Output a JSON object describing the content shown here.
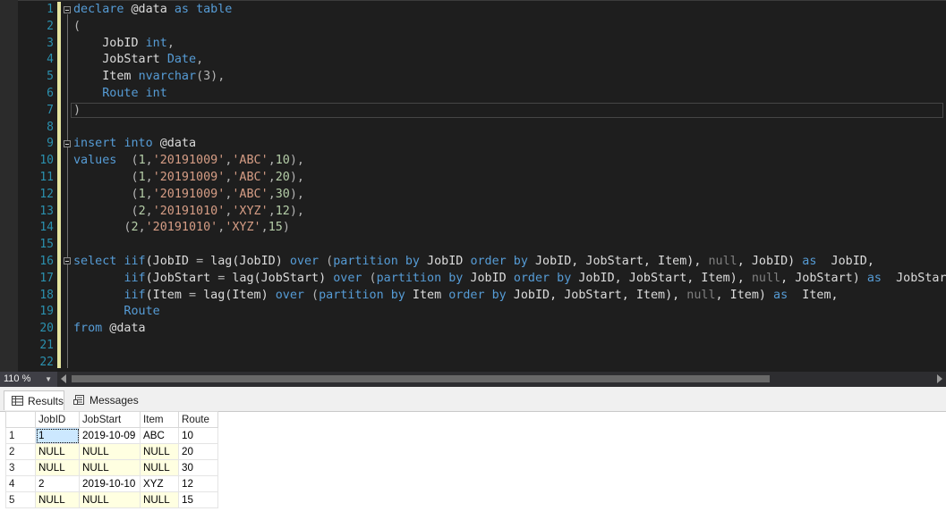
{
  "editor": {
    "line_numbers": [
      "1",
      "2",
      "3",
      "4",
      "5",
      "6",
      "7",
      "8",
      "9",
      "10",
      "11",
      "12",
      "13",
      "14",
      "15",
      "16",
      "17",
      "18",
      "19",
      "20",
      "21",
      "22"
    ],
    "lines": [
      [
        {
          "t": "declare",
          "c": "kw"
        },
        {
          "t": " @data ",
          "c": "fn"
        },
        {
          "t": "as",
          "c": "kw"
        },
        {
          "t": " ",
          "c": "fn"
        },
        {
          "t": "table",
          "c": "kw"
        }
      ],
      [
        {
          "t": "(",
          "c": "pun"
        }
      ],
      [
        {
          "t": "    JobID ",
          "c": "fn"
        },
        {
          "t": "int",
          "c": "kw"
        },
        {
          "t": ",",
          "c": "pun"
        }
      ],
      [
        {
          "t": "    JobStart ",
          "c": "fn"
        },
        {
          "t": "Date",
          "c": "kw"
        },
        {
          "t": ",",
          "c": "pun"
        }
      ],
      [
        {
          "t": "    Item ",
          "c": "fn"
        },
        {
          "t": "nvarchar",
          "c": "kw"
        },
        {
          "t": "(3),",
          "c": "pun"
        }
      ],
      [
        {
          "t": "    Route ",
          "c": "kw"
        },
        {
          "t": "int",
          "c": "kw"
        }
      ],
      [
        {
          "t": ")",
          "c": "pun"
        }
      ],
      [],
      [
        {
          "t": "insert",
          "c": "kw"
        },
        {
          "t": " ",
          "c": "fn"
        },
        {
          "t": "into",
          "c": "kw"
        },
        {
          "t": " @data",
          "c": "fn"
        }
      ],
      [
        {
          "t": "values",
          "c": "kw"
        },
        {
          "t": "  (",
          "c": "pun"
        },
        {
          "t": "1",
          "c": "num"
        },
        {
          "t": ",",
          "c": "pun"
        },
        {
          "t": "'20191009'",
          "c": "str"
        },
        {
          "t": ",",
          "c": "pun"
        },
        {
          "t": "'ABC'",
          "c": "str"
        },
        {
          "t": ",",
          "c": "pun"
        },
        {
          "t": "10",
          "c": "num"
        },
        {
          "t": "),",
          "c": "pun"
        }
      ],
      [
        {
          "t": "        (",
          "c": "pun"
        },
        {
          "t": "1",
          "c": "num"
        },
        {
          "t": ",",
          "c": "pun"
        },
        {
          "t": "'20191009'",
          "c": "str"
        },
        {
          "t": ",",
          "c": "pun"
        },
        {
          "t": "'ABC'",
          "c": "str"
        },
        {
          "t": ",",
          "c": "pun"
        },
        {
          "t": "20",
          "c": "num"
        },
        {
          "t": "),",
          "c": "pun"
        }
      ],
      [
        {
          "t": "        (",
          "c": "pun"
        },
        {
          "t": "1",
          "c": "num"
        },
        {
          "t": ",",
          "c": "pun"
        },
        {
          "t": "'20191009'",
          "c": "str"
        },
        {
          "t": ",",
          "c": "pun"
        },
        {
          "t": "'ABC'",
          "c": "str"
        },
        {
          "t": ",",
          "c": "pun"
        },
        {
          "t": "30",
          "c": "num"
        },
        {
          "t": "),",
          "c": "pun"
        }
      ],
      [
        {
          "t": "        (",
          "c": "pun"
        },
        {
          "t": "2",
          "c": "num"
        },
        {
          "t": ",",
          "c": "pun"
        },
        {
          "t": "'20191010'",
          "c": "str"
        },
        {
          "t": ",",
          "c": "pun"
        },
        {
          "t": "'XYZ'",
          "c": "str"
        },
        {
          "t": ",",
          "c": "pun"
        },
        {
          "t": "12",
          "c": "num"
        },
        {
          "t": "),",
          "c": "pun"
        }
      ],
      [
        {
          "t": "       (",
          "c": "pun"
        },
        {
          "t": "2",
          "c": "num"
        },
        {
          "t": ",",
          "c": "pun"
        },
        {
          "t": "'20191010'",
          "c": "str"
        },
        {
          "t": ",",
          "c": "pun"
        },
        {
          "t": "'XYZ'",
          "c": "str"
        },
        {
          "t": ",",
          "c": "pun"
        },
        {
          "t": "15",
          "c": "num"
        },
        {
          "t": ")",
          "c": "pun"
        }
      ],
      [],
      [
        {
          "t": "select",
          "c": "kw"
        },
        {
          "t": " ",
          "c": "fn"
        },
        {
          "t": "iif",
          "c": "kw"
        },
        {
          "t": "(JobID ",
          "c": "fn"
        },
        {
          "t": "=",
          "c": "pun"
        },
        {
          "t": " lag(JobID) ",
          "c": "fn"
        },
        {
          "t": "over",
          "c": "kw"
        },
        {
          "t": " (",
          "c": "pun"
        },
        {
          "t": "partition by",
          "c": "kw"
        },
        {
          "t": " JobID ",
          "c": "fn"
        },
        {
          "t": "order by",
          "c": "kw"
        },
        {
          "t": " JobID, JobStart, Item), ",
          "c": "fn"
        },
        {
          "t": "null",
          "c": "gray"
        },
        {
          "t": ", JobID) ",
          "c": "fn"
        },
        {
          "t": "as",
          "c": "kw"
        },
        {
          "t": "  JobID,",
          "c": "fn"
        }
      ],
      [
        {
          "t": "       ",
          "c": "fn"
        },
        {
          "t": "iif",
          "c": "kw"
        },
        {
          "t": "(JobStart ",
          "c": "fn"
        },
        {
          "t": "=",
          "c": "pun"
        },
        {
          "t": " lag(JobStart) ",
          "c": "fn"
        },
        {
          "t": "over",
          "c": "kw"
        },
        {
          "t": " (",
          "c": "pun"
        },
        {
          "t": "partition by",
          "c": "kw"
        },
        {
          "t": " JobID ",
          "c": "fn"
        },
        {
          "t": "order by",
          "c": "kw"
        },
        {
          "t": " JobID, JobStart, Item), ",
          "c": "fn"
        },
        {
          "t": "null",
          "c": "gray"
        },
        {
          "t": ", JobStart) ",
          "c": "fn"
        },
        {
          "t": "as",
          "c": "kw"
        },
        {
          "t": "  JobStart,",
          "c": "fn"
        }
      ],
      [
        {
          "t": "       ",
          "c": "fn"
        },
        {
          "t": "iif",
          "c": "kw"
        },
        {
          "t": "(Item ",
          "c": "fn"
        },
        {
          "t": "=",
          "c": "pun"
        },
        {
          "t": " lag(Item) ",
          "c": "fn"
        },
        {
          "t": "over",
          "c": "kw"
        },
        {
          "t": " (",
          "c": "pun"
        },
        {
          "t": "partition by",
          "c": "kw"
        },
        {
          "t": " Item ",
          "c": "fn"
        },
        {
          "t": "order by",
          "c": "kw"
        },
        {
          "t": " JobID, JobStart, Item), ",
          "c": "fn"
        },
        {
          "t": "null",
          "c": "gray"
        },
        {
          "t": ", Item) ",
          "c": "fn"
        },
        {
          "t": "as",
          "c": "kw"
        },
        {
          "t": "  Item,",
          "c": "fn"
        }
      ],
      [
        {
          "t": "       Route",
          "c": "kw"
        }
      ],
      [
        {
          "t": "from",
          "c": "kw"
        },
        {
          "t": " @data",
          "c": "fn"
        }
      ],
      [],
      []
    ]
  },
  "statusbar": {
    "zoom": "110 %"
  },
  "results": {
    "tabs": [
      {
        "label": "Results"
      },
      {
        "label": "Messages"
      }
    ],
    "grid": {
      "columns": [
        "",
        "JobID",
        "JobStart",
        "Item",
        "Route"
      ],
      "rows": [
        [
          "1",
          "1",
          "2019-10-09",
          "ABC",
          "10"
        ],
        [
          "2",
          "NULL",
          "NULL",
          "NULL",
          "20"
        ],
        [
          "3",
          "NULL",
          "NULL",
          "NULL",
          "30"
        ],
        [
          "4",
          "2",
          "2019-10-10",
          "XYZ",
          "12"
        ],
        [
          "5",
          "NULL",
          "NULL",
          "NULL",
          "15"
        ]
      ]
    }
  }
}
